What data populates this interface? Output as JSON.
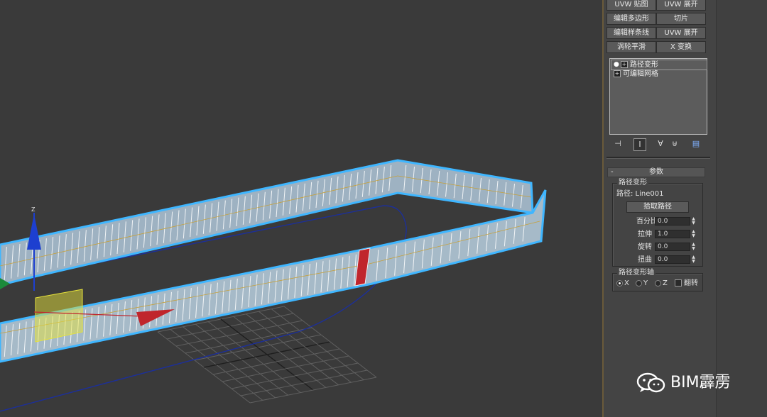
{
  "modifier_buttons": [
    {
      "label": "UVW 贴图"
    },
    {
      "label": "UVW 展开"
    },
    {
      "label": "编辑多边形"
    },
    {
      "label": "切片"
    },
    {
      "label": "编辑样条线"
    },
    {
      "label": "UVW 展开"
    },
    {
      "label": "涡轮平滑"
    },
    {
      "label": "X 变换"
    }
  ],
  "stack": {
    "items": [
      {
        "label": "路径变形",
        "selected": true
      },
      {
        "label": "可编辑网格",
        "selected": false
      }
    ]
  },
  "stack_toolbar": {
    "icons": [
      "pin-stack-icon",
      "show-end-result-icon",
      "make-unique-icon",
      "remove-modifier-icon",
      "configure-sets-icon"
    ]
  },
  "rollout": {
    "title": "参数",
    "collapse_symbol": "-",
    "path_deform_group": "路径变形",
    "path_label": "路径: Line001",
    "pick_path_button": "拾取路径",
    "params": [
      {
        "label": "百分比",
        "value": "0.0"
      },
      {
        "label": "拉伸",
        "value": "1.0"
      },
      {
        "label": "旋转",
        "value": "0.0"
      },
      {
        "label": "扭曲",
        "value": "0.0"
      }
    ],
    "axis_group": "路径变形轴",
    "axes": [
      {
        "label": "X",
        "selected": true
      },
      {
        "label": "Y",
        "selected": false
      },
      {
        "label": "Z",
        "selected": false
      }
    ],
    "flip_label": "翻转"
  },
  "watermark": {
    "text": "BIM霹雳",
    "icon": "wechat-icon"
  },
  "colors": {
    "viewport_bg": "#3a3a3a",
    "panel_bg": "#444444",
    "selection_outline": "#3fb6ff",
    "ribbon_fill": "#9fb3c3",
    "gizmo_red": "#c0262c",
    "gizmo_blue": "#1d3fd0",
    "gizmo_green": "#1b8a3a",
    "gizmo_yellow": "#e6e23a"
  },
  "viewport": {
    "gizmo_axis_label": "Z"
  }
}
